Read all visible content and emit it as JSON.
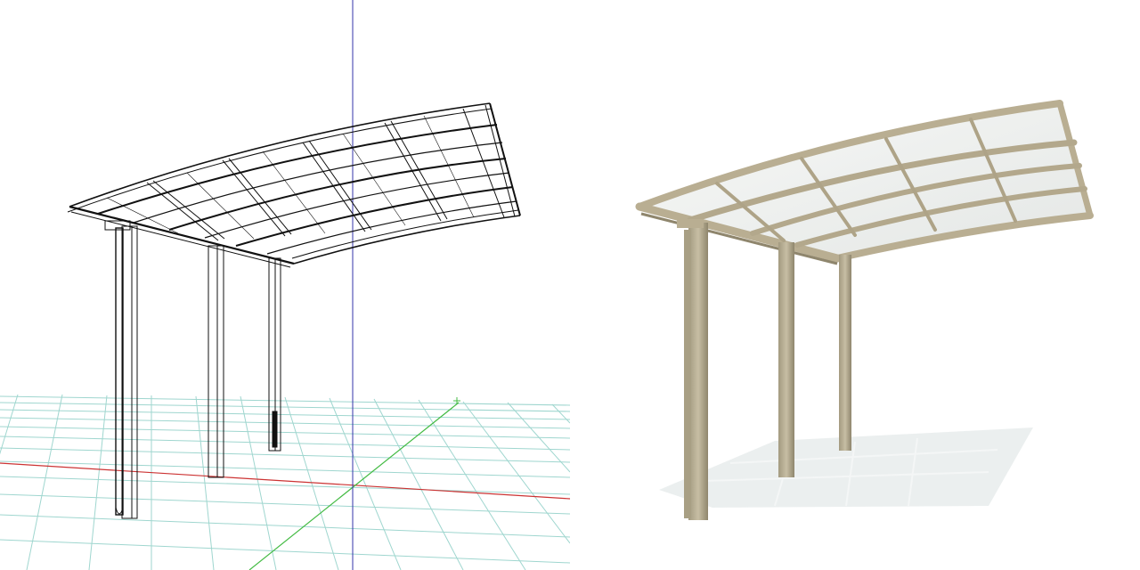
{
  "scene": {
    "subject": "carport",
    "views": [
      {
        "id": "wireframe",
        "render_style": "wireframe"
      },
      {
        "id": "shaded",
        "render_style": "shaded"
      }
    ]
  },
  "colors": {
    "background": "#ffffff",
    "wire_stroke": "#111111",
    "grid_cyan": "#9fd6cf",
    "axis_x": "#cc3333",
    "axis_y": "#44bb44",
    "axis_z": "#3333aa",
    "frame_beige": "#b9ae92",
    "frame_shadow": "#8f866d",
    "panel_glass": "#eef0ef",
    "floor_reflection": "#e7ecec"
  },
  "icons": {
    "axis_triad": "xyz-axis-icon"
  }
}
